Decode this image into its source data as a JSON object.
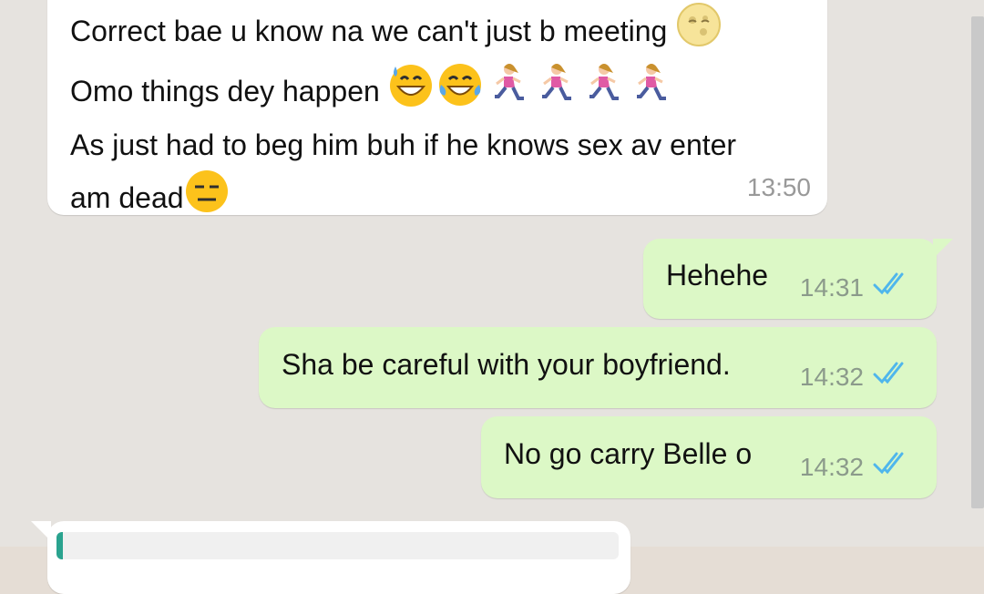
{
  "messages": [
    {
      "direction": "incoming",
      "lines": [
        "Correct bae u know na we can't just b meeting",
        "Omo things dey happen",
        "As just had to beg him buh if he knows sex av enter",
        "am dead"
      ],
      "time": "13:50"
    },
    {
      "direction": "outgoing",
      "text": "Hehehe",
      "time": "14:31",
      "status": "read"
    },
    {
      "direction": "outgoing",
      "text": "Sha be careful with your boyfriend.",
      "time": "14:32",
      "status": "read"
    },
    {
      "direction": "outgoing",
      "text": "No go carry Belle o",
      "time": "14:32",
      "status": "read"
    }
  ],
  "icons": {
    "moon": "moon-face-emoji",
    "sweat": "grinning-sweat-emoji",
    "joy": "tears-of-joy-emoji",
    "runner": "woman-running-emoji",
    "expressionless": "expressionless-face-emoji",
    "ticks": "double-check-icon"
  },
  "colors": {
    "chat_bg": "#e6e3df",
    "incoming_bubble": "#ffffff",
    "outgoing_bubble": "#dcf8c6",
    "read_ticks": "#4fb6ec",
    "quote_accent": "#2aa38f"
  }
}
